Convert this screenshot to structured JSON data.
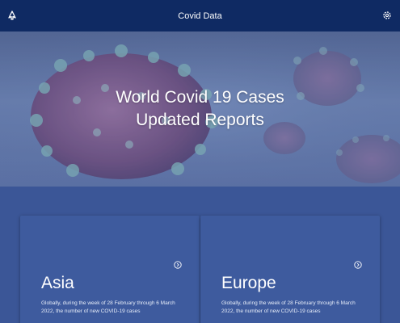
{
  "app": {
    "title": "Covid Data"
  },
  "topbar": {
    "left_icon": "navigation-icon",
    "right_icon": "gear-icon"
  },
  "hero": {
    "headline_line1": "World Covid 19 Cases",
    "headline_line2": "Updated Reports"
  },
  "cards": [
    {
      "region": "Asia",
      "description": "Globally, during the week of 28 February through 6 March 2022, the number of new COVID-19 cases",
      "icon": "chevron-right-circle-icon"
    },
    {
      "region": "Europe",
      "description": "Globally, during the week of 28 February through 6 March 2022, the number of new COVID-19 cases",
      "icon": "chevron-right-circle-icon"
    }
  ],
  "colors": {
    "topbar": "#0f2a63",
    "page_background": "#3b5697",
    "card_background": "#3e5b9e",
    "virus": "#7a4a7e"
  }
}
